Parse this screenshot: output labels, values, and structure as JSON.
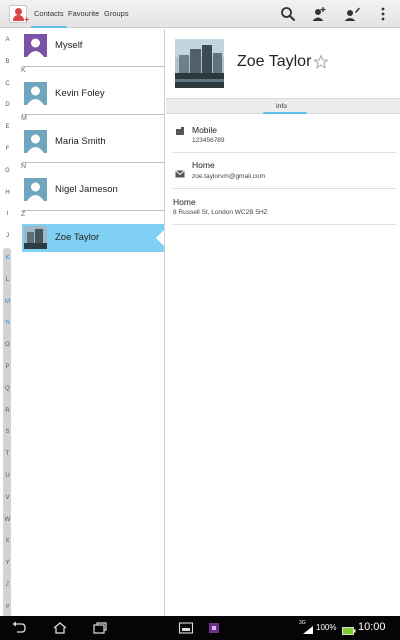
{
  "topbar": {
    "tabs": [
      "Contacts",
      "Favourite",
      "Groups"
    ],
    "active_tab": "Contacts",
    "icons": [
      "contacts-app-icon",
      "search-icon",
      "add-contact-icon",
      "edit-contact-icon",
      "overflow-menu-icon"
    ]
  },
  "index_letters": [
    "A",
    "B",
    "C",
    "D",
    "E",
    "F",
    "G",
    "H",
    "I",
    "J",
    "K",
    "L",
    "M",
    "N",
    "O",
    "P",
    "Q",
    "R",
    "S",
    "T",
    "U",
    "V",
    "W",
    "X",
    "Y",
    "Z",
    "#"
  ],
  "index_active": [
    "K",
    "M",
    "N",
    "Z"
  ],
  "list": {
    "sections": [
      "K",
      "M",
      "N",
      "Z"
    ],
    "contacts": [
      {
        "name": "Myself"
      },
      {
        "name": "Kevin Foley"
      },
      {
        "name": "Maria Smith"
      },
      {
        "name": "Nigel Jameson"
      },
      {
        "name": "Zoe Taylor"
      }
    ],
    "selected": "Zoe Taylor"
  },
  "detail": {
    "name": "Zoe Taylor",
    "tab_label": "Info",
    "fields": [
      {
        "title": "Mobile",
        "value": "123456789",
        "icon": "phone-icon"
      },
      {
        "title": "Home",
        "value": "zoe.taylorvm@gmail.com",
        "icon": "email-icon"
      },
      {
        "title": "Home",
        "value": "8 Russell St, London WC2B 5HZ",
        "icon": ""
      }
    ]
  },
  "statusbar": {
    "network": "3G",
    "battery": "100%",
    "time": "10:00"
  },
  "colors": {
    "accent": "#5bbfe8",
    "selected_row": "#7fd0f2",
    "index_active": "#2c8fd0"
  }
}
